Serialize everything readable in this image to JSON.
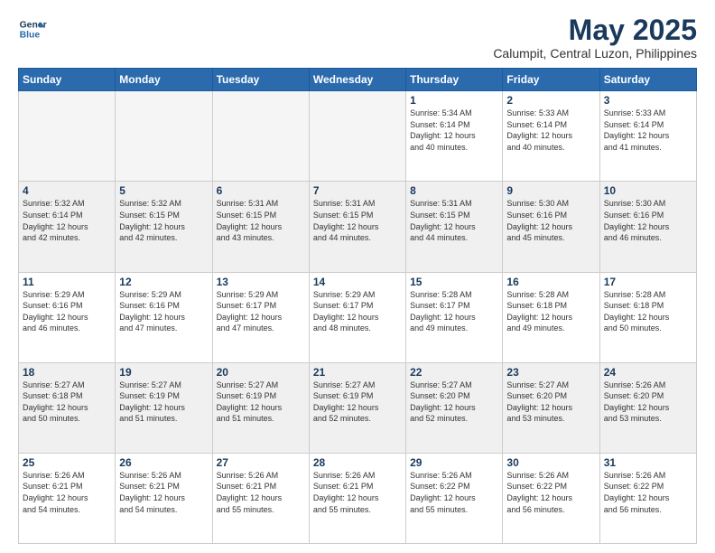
{
  "logo": {
    "line1": "General",
    "line2": "Blue"
  },
  "title": "May 2025",
  "subtitle": "Calumpit, Central Luzon, Philippines",
  "headers": [
    "Sunday",
    "Monday",
    "Tuesday",
    "Wednesday",
    "Thursday",
    "Friday",
    "Saturday"
  ],
  "weeks": [
    [
      {
        "day": "",
        "info": ""
      },
      {
        "day": "",
        "info": ""
      },
      {
        "day": "",
        "info": ""
      },
      {
        "day": "",
        "info": ""
      },
      {
        "day": "1",
        "info": "Sunrise: 5:34 AM\nSunset: 6:14 PM\nDaylight: 12 hours\nand 40 minutes."
      },
      {
        "day": "2",
        "info": "Sunrise: 5:33 AM\nSunset: 6:14 PM\nDaylight: 12 hours\nand 40 minutes."
      },
      {
        "day": "3",
        "info": "Sunrise: 5:33 AM\nSunset: 6:14 PM\nDaylight: 12 hours\nand 41 minutes."
      }
    ],
    [
      {
        "day": "4",
        "info": "Sunrise: 5:32 AM\nSunset: 6:14 PM\nDaylight: 12 hours\nand 42 minutes."
      },
      {
        "day": "5",
        "info": "Sunrise: 5:32 AM\nSunset: 6:15 PM\nDaylight: 12 hours\nand 42 minutes."
      },
      {
        "day": "6",
        "info": "Sunrise: 5:31 AM\nSunset: 6:15 PM\nDaylight: 12 hours\nand 43 minutes."
      },
      {
        "day": "7",
        "info": "Sunrise: 5:31 AM\nSunset: 6:15 PM\nDaylight: 12 hours\nand 44 minutes."
      },
      {
        "day": "8",
        "info": "Sunrise: 5:31 AM\nSunset: 6:15 PM\nDaylight: 12 hours\nand 44 minutes."
      },
      {
        "day": "9",
        "info": "Sunrise: 5:30 AM\nSunset: 6:16 PM\nDaylight: 12 hours\nand 45 minutes."
      },
      {
        "day": "10",
        "info": "Sunrise: 5:30 AM\nSunset: 6:16 PM\nDaylight: 12 hours\nand 46 minutes."
      }
    ],
    [
      {
        "day": "11",
        "info": "Sunrise: 5:29 AM\nSunset: 6:16 PM\nDaylight: 12 hours\nand 46 minutes."
      },
      {
        "day": "12",
        "info": "Sunrise: 5:29 AM\nSunset: 6:16 PM\nDaylight: 12 hours\nand 47 minutes."
      },
      {
        "day": "13",
        "info": "Sunrise: 5:29 AM\nSunset: 6:17 PM\nDaylight: 12 hours\nand 47 minutes."
      },
      {
        "day": "14",
        "info": "Sunrise: 5:29 AM\nSunset: 6:17 PM\nDaylight: 12 hours\nand 48 minutes."
      },
      {
        "day": "15",
        "info": "Sunrise: 5:28 AM\nSunset: 6:17 PM\nDaylight: 12 hours\nand 49 minutes."
      },
      {
        "day": "16",
        "info": "Sunrise: 5:28 AM\nSunset: 6:18 PM\nDaylight: 12 hours\nand 49 minutes."
      },
      {
        "day": "17",
        "info": "Sunrise: 5:28 AM\nSunset: 6:18 PM\nDaylight: 12 hours\nand 50 minutes."
      }
    ],
    [
      {
        "day": "18",
        "info": "Sunrise: 5:27 AM\nSunset: 6:18 PM\nDaylight: 12 hours\nand 50 minutes."
      },
      {
        "day": "19",
        "info": "Sunrise: 5:27 AM\nSunset: 6:19 PM\nDaylight: 12 hours\nand 51 minutes."
      },
      {
        "day": "20",
        "info": "Sunrise: 5:27 AM\nSunset: 6:19 PM\nDaylight: 12 hours\nand 51 minutes."
      },
      {
        "day": "21",
        "info": "Sunrise: 5:27 AM\nSunset: 6:19 PM\nDaylight: 12 hours\nand 52 minutes."
      },
      {
        "day": "22",
        "info": "Sunrise: 5:27 AM\nSunset: 6:20 PM\nDaylight: 12 hours\nand 52 minutes."
      },
      {
        "day": "23",
        "info": "Sunrise: 5:27 AM\nSunset: 6:20 PM\nDaylight: 12 hours\nand 53 minutes."
      },
      {
        "day": "24",
        "info": "Sunrise: 5:26 AM\nSunset: 6:20 PM\nDaylight: 12 hours\nand 53 minutes."
      }
    ],
    [
      {
        "day": "25",
        "info": "Sunrise: 5:26 AM\nSunset: 6:21 PM\nDaylight: 12 hours\nand 54 minutes."
      },
      {
        "day": "26",
        "info": "Sunrise: 5:26 AM\nSunset: 6:21 PM\nDaylight: 12 hours\nand 54 minutes."
      },
      {
        "day": "27",
        "info": "Sunrise: 5:26 AM\nSunset: 6:21 PM\nDaylight: 12 hours\nand 55 minutes."
      },
      {
        "day": "28",
        "info": "Sunrise: 5:26 AM\nSunset: 6:21 PM\nDaylight: 12 hours\nand 55 minutes."
      },
      {
        "day": "29",
        "info": "Sunrise: 5:26 AM\nSunset: 6:22 PM\nDaylight: 12 hours\nand 55 minutes."
      },
      {
        "day": "30",
        "info": "Sunrise: 5:26 AM\nSunset: 6:22 PM\nDaylight: 12 hours\nand 56 minutes."
      },
      {
        "day": "31",
        "info": "Sunrise: 5:26 AM\nSunset: 6:22 PM\nDaylight: 12 hours\nand 56 minutes."
      }
    ]
  ]
}
